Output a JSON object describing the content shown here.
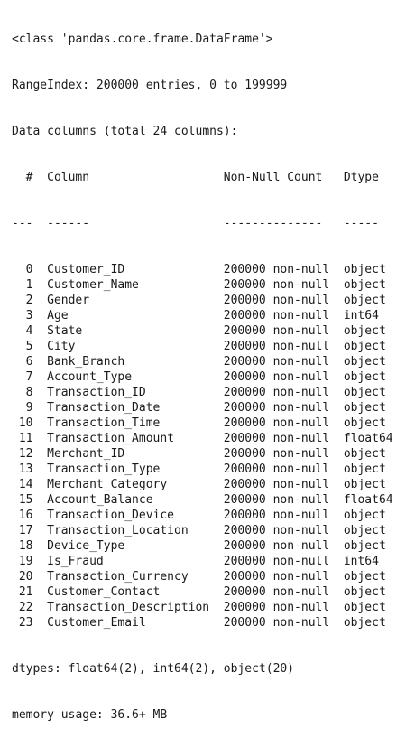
{
  "header": {
    "class_line": "<class 'pandas.core.frame.DataFrame'>",
    "range_index": "RangeIndex: 200000 entries, 0 to 199999",
    "data_columns": "Data columns (total 24 columns):"
  },
  "table_header": {
    "num": "#",
    "column": "Column",
    "count": "Non-Null Count",
    "dtype": "Dtype"
  },
  "table_dashes": {
    "num": "---",
    "column": "------",
    "count": "--------------",
    "dtype": "-----"
  },
  "rows": [
    {
      "i": "0",
      "name": "Customer_ID",
      "count": "200000 non-null",
      "dtype": "object"
    },
    {
      "i": "1",
      "name": "Customer_Name",
      "count": "200000 non-null",
      "dtype": "object"
    },
    {
      "i": "2",
      "name": "Gender",
      "count": "200000 non-null",
      "dtype": "object"
    },
    {
      "i": "3",
      "name": "Age",
      "count": "200000 non-null",
      "dtype": "int64"
    },
    {
      "i": "4",
      "name": "State",
      "count": "200000 non-null",
      "dtype": "object"
    },
    {
      "i": "5",
      "name": "City",
      "count": "200000 non-null",
      "dtype": "object"
    },
    {
      "i": "6",
      "name": "Bank_Branch",
      "count": "200000 non-null",
      "dtype": "object"
    },
    {
      "i": "7",
      "name": "Account_Type",
      "count": "200000 non-null",
      "dtype": "object"
    },
    {
      "i": "8",
      "name": "Transaction_ID",
      "count": "200000 non-null",
      "dtype": "object"
    },
    {
      "i": "9",
      "name": "Transaction_Date",
      "count": "200000 non-null",
      "dtype": "object"
    },
    {
      "i": "10",
      "name": "Transaction_Time",
      "count": "200000 non-null",
      "dtype": "object"
    },
    {
      "i": "11",
      "name": "Transaction_Amount",
      "count": "200000 non-null",
      "dtype": "float64"
    },
    {
      "i": "12",
      "name": "Merchant_ID",
      "count": "200000 non-null",
      "dtype": "object"
    },
    {
      "i": "13",
      "name": "Transaction_Type",
      "count": "200000 non-null",
      "dtype": "object"
    },
    {
      "i": "14",
      "name": "Merchant_Category",
      "count": "200000 non-null",
      "dtype": "object"
    },
    {
      "i": "15",
      "name": "Account_Balance",
      "count": "200000 non-null",
      "dtype": "float64"
    },
    {
      "i": "16",
      "name": "Transaction_Device",
      "count": "200000 non-null",
      "dtype": "object"
    },
    {
      "i": "17",
      "name": "Transaction_Location",
      "count": "200000 non-null",
      "dtype": "object"
    },
    {
      "i": "18",
      "name": "Device_Type",
      "count": "200000 non-null",
      "dtype": "object"
    },
    {
      "i": "19",
      "name": "Is_Fraud",
      "count": "200000 non-null",
      "dtype": "int64"
    },
    {
      "i": "20",
      "name": "Transaction_Currency",
      "count": "200000 non-null",
      "dtype": "object"
    },
    {
      "i": "21",
      "name": "Customer_Contact",
      "count": "200000 non-null",
      "dtype": "object"
    },
    {
      "i": "22",
      "name": "Transaction_Description",
      "count": "200000 non-null",
      "dtype": "object"
    },
    {
      "i": "23",
      "name": "Customer_Email",
      "count": "200000 non-null",
      "dtype": "object"
    }
  ],
  "footer": {
    "dtypes": "dtypes: float64(2), int64(2), object(20)",
    "memory": "memory usage: 36.6+ MB"
  }
}
